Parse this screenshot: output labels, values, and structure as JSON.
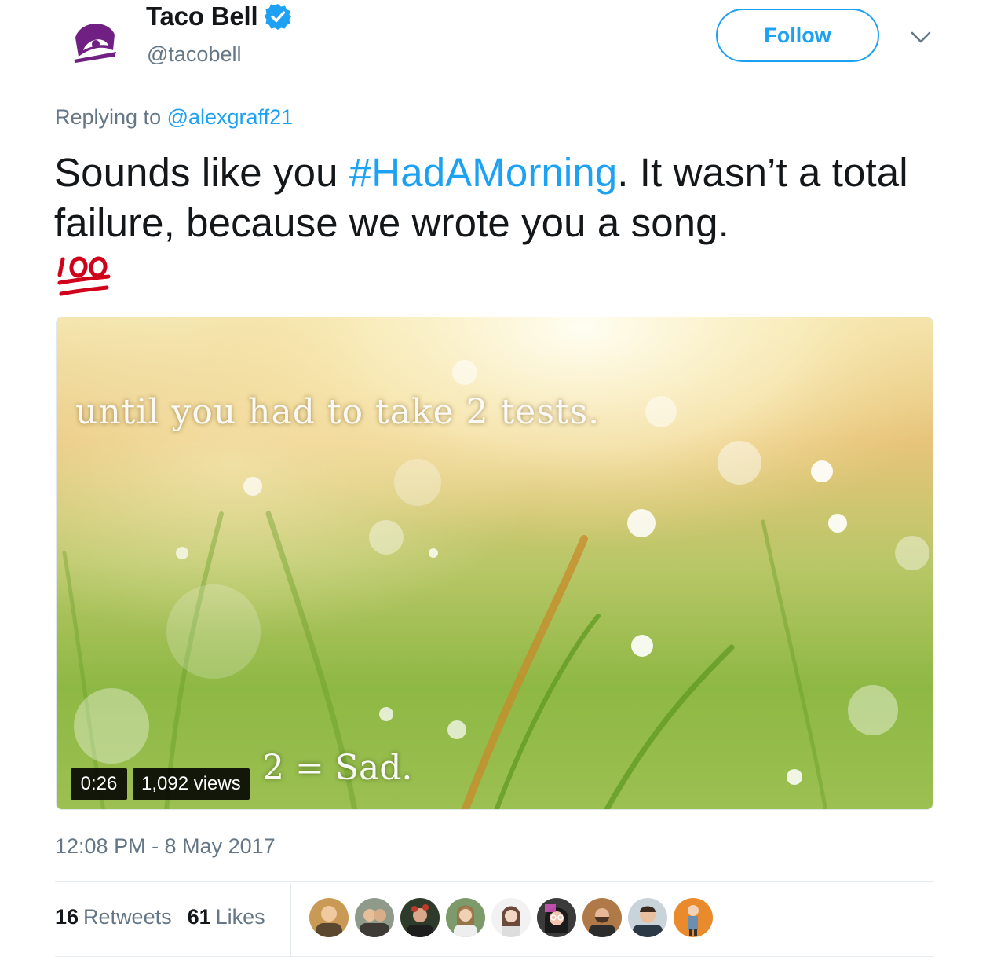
{
  "author": {
    "display_name": "Taco Bell",
    "handle": "@tacobell",
    "verified": true,
    "avatar_icon": "taco-bell-logo",
    "brand_color": "#702082"
  },
  "follow_label": "Follow",
  "menu_icon": "chevron-down-icon",
  "reply": {
    "prefix": "Replying to ",
    "mention": "@alexgraff21"
  },
  "tweet": {
    "text_before": "Sounds like you ",
    "hashtag": "#HadAMorning",
    "text_after": ". It wasn’t a total failure, because we wrote you a song.",
    "emoji": "hundred-points-emoji"
  },
  "video": {
    "caption_top": "until you had to take 2 tests.",
    "caption_bottom": "2 = Sad.",
    "duration": "0:26",
    "views": "1,092 views"
  },
  "timestamp": "12:08 PM - 8 May 2017",
  "stats": {
    "retweets_count": "16",
    "retweets_label": "Retweets",
    "likes_count": "61",
    "likes_label": "Likes"
  },
  "liker_avatars": 9,
  "colors": {
    "link": "#1da1f2",
    "secondary_text": "#657786",
    "primary_text": "#14171a"
  }
}
